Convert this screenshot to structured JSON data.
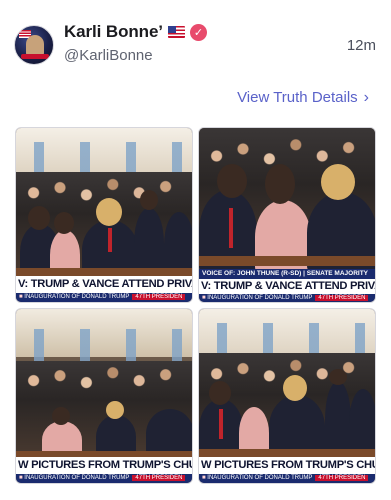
{
  "post": {
    "display_name": "Karli Bonne’",
    "handle": "@KarliBonne",
    "timestamp": "12m",
    "details_link": "View Truth Details"
  },
  "media": [
    {
      "chyron_headline": "V: TRUMP & VANCE ATTEND PRIVATE CHUI",
      "chyron_ticker": "INAUGURATION OF DONALD TRUMP",
      "chyron_badge": "47TH PRESIDEN"
    },
    {
      "chyron_topline": "VOICE OF: JOHN THUNE (R-SD) | SENATE MAJORITY",
      "chyron_headline": "V: TRUMP & VANCE ATTEND PRIVATE CHURC",
      "chyron_ticker": "INAUGURATION OF DONALD TRUMP",
      "chyron_badge": "47TH PRESIDEN"
    },
    {
      "chyron_headline": "W PICTURES FROM TRUMP'S CHURCH",
      "chyron_ticker": "INAUGURATION OF DONALD TRUMP",
      "chyron_badge": "47TH PRESIDEN"
    },
    {
      "chyron_headline": "W PICTURES FROM TRUMP'S CHURCH",
      "chyron_ticker": "INAUGURATION OF DONALD TRUMP",
      "chyron_badge": "47TH PRESIDEN"
    }
  ],
  "icons": {
    "verified": "verified-badge-icon",
    "flag": "us-flag-icon",
    "chevron": "chevron-right-icon"
  },
  "colors": {
    "link": "#5a62c9",
    "verified": "#e84b6c",
    "chyron_blue": "#1a2b6e"
  }
}
